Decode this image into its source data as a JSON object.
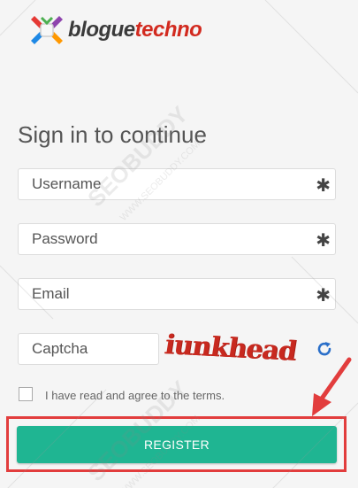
{
  "logo": {
    "part1": "blogue",
    "part2": "techno"
  },
  "heading": "Sign in to continue",
  "form": {
    "username_placeholder": "Username",
    "password_placeholder": "Password",
    "email_placeholder": "Email",
    "captcha_placeholder": "Captcha",
    "required_mark": "✱",
    "captcha_text": "iunkhead",
    "terms_label": "I have read and agree to the terms.",
    "register_label": "REGISTER"
  },
  "icons": {
    "refresh": "refresh-icon",
    "required": "asterisk-icon",
    "annotation": "red-arrow"
  },
  "watermark": {
    "brand": "SEOBUDDY",
    "url": "WWW.SEOBUDDY.COM"
  },
  "colors": {
    "accent": "#1fb592",
    "highlight": "#e23d3d",
    "brand_red": "#d22a1f",
    "refresh_blue": "#2a6fc9"
  }
}
